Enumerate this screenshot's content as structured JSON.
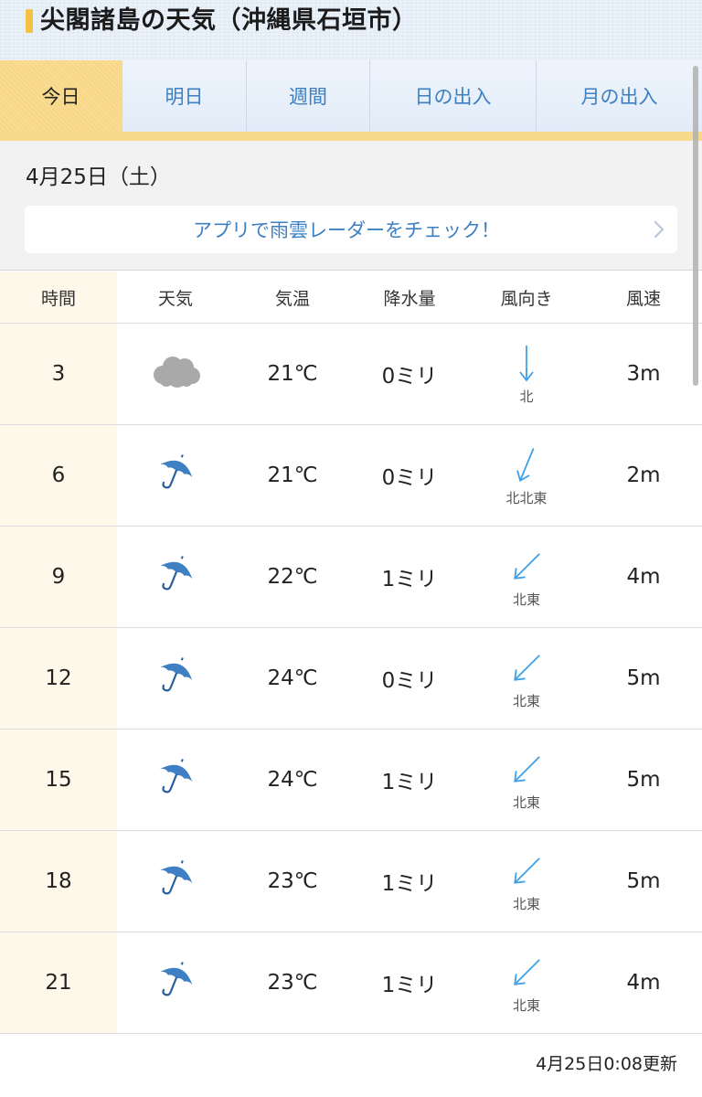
{
  "header": {
    "title": "尖閣諸島の天気（沖縄県石垣市）"
  },
  "tabs": [
    {
      "label": "今日",
      "active": true
    },
    {
      "label": "明日",
      "active": false
    },
    {
      "label": "週間",
      "active": false
    },
    {
      "label": "日の出入",
      "active": false
    },
    {
      "label": "月の出入",
      "active": false
    }
  ],
  "date": "4月25日（土）",
  "promo": {
    "text": "アプリで雨雲レーダーをチェック！"
  },
  "table": {
    "headers": [
      "時間",
      "天気",
      "気温",
      "降水量",
      "風向き",
      "風速"
    ],
    "rows": [
      {
        "time": "3",
        "weather_icon": "cloud-icon",
        "temp": "21℃",
        "rain": "0ミリ",
        "wind_dir": "北",
        "wind_deg": 0,
        "speed": "3m"
      },
      {
        "time": "6",
        "weather_icon": "umbrella-icon",
        "temp": "21℃",
        "rain": "0ミリ",
        "wind_dir": "北北東",
        "wind_deg": 22.5,
        "speed": "2m"
      },
      {
        "time": "9",
        "weather_icon": "umbrella-icon",
        "temp": "22℃",
        "rain": "1ミリ",
        "wind_dir": "北東",
        "wind_deg": 45,
        "speed": "4m"
      },
      {
        "time": "12",
        "weather_icon": "umbrella-icon",
        "temp": "24℃",
        "rain": "0ミリ",
        "wind_dir": "北東",
        "wind_deg": 45,
        "speed": "5m"
      },
      {
        "time": "15",
        "weather_icon": "umbrella-icon",
        "temp": "24℃",
        "rain": "1ミリ",
        "wind_dir": "北東",
        "wind_deg": 45,
        "speed": "5m"
      },
      {
        "time": "18",
        "weather_icon": "umbrella-icon",
        "temp": "23℃",
        "rain": "1ミリ",
        "wind_dir": "北東",
        "wind_deg": 45,
        "speed": "5m"
      },
      {
        "time": "21",
        "weather_icon": "umbrella-icon",
        "temp": "23℃",
        "rain": "1ミリ",
        "wind_dir": "北東",
        "wind_deg": 45,
        "speed": "4m"
      }
    ]
  },
  "updated": "4月25日0:08更新",
  "colors": {
    "accent_blue": "#3d7fc1",
    "tab_active": "#f8d888",
    "cloud_gray": "#a9a9a9",
    "umbrella_blue": "#3f7fc4",
    "arrow_blue": "#3fa0e6"
  }
}
